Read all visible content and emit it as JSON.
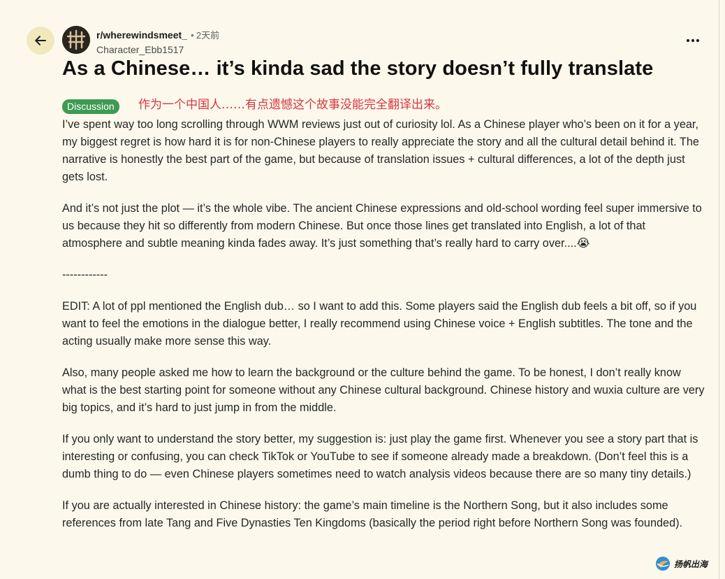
{
  "header": {
    "subreddit": "r/wherewindsmeet_",
    "separator": "•",
    "time": "2天前",
    "author": "Character_Ebb1517",
    "back_icon": "arrow-left-icon",
    "more_icon": "more-horizontal-icon"
  },
  "post": {
    "title": "As a Chinese… it’s kinda sad the story doesn’t fully translate",
    "flair": "Discussion",
    "title_translation": "作为一个中国人……有点遗憾这个故事没能完全翻译出来。",
    "paragraphs": [
      "I’ve spent way too long scrolling through WWM reviews just out of curiosity lol. As a Chinese player who’s been on it for a year, my biggest regret is how hard it is for non-Chinese players to really appreciate the story and all the cultural detail behind it. The narrative is honestly the best part of the game, but because of translation issues + cultural differences, a lot of the depth just gets lost.",
      "And it’s not just the plot — it’s the whole vibe. The ancient Chinese expressions and old-school wording feel super immersive to us because they hit so differently from modern Chinese. But once those lines get translated into English, a lot of that atmosphere and subtle meaning kinda fades away. It’s just something that’s really hard to carry over....😭",
      "------------",
      "EDIT: A lot of ppl mentioned the English dub… so I want to add this. Some players said the English dub feels a bit off, so if you want to feel the emotions in the dialogue better, I really recommend using Chinese voice + English subtitles. The tone and the acting usually make more sense this way.",
      "Also, many people asked me how to learn the background or the culture behind the game. To be honest, I don’t really know what is the best starting point for someone without any Chinese cultural background. Chinese history and wuxia culture are very big topics, and it’s hard to just jump in from the middle.",
      "If you only want to understand the story better, my suggestion is: just play the game first. Whenever you see a story part that is interesting or confusing, you can check TikTok or YouTube to see if someone already made a breakdown. (Don’t feel this is a dumb thing to do — even Chinese players sometimes need to watch analysis videos because there are so many tiny details.)",
      "If you are actually interested in Chinese history: the game’s main timeline is the Northern Song, but it also includes some references from late Tang and Five Dynasties Ten Kingdoms (basically the period right before Northern Song was founded)."
    ]
  },
  "watermark": {
    "text": "扬帆出海",
    "icon": "globe-logo-icon"
  },
  "colors": {
    "background": "#fcf9ec",
    "back_button_bg": "#f1e9bd",
    "flair_bg": "#3f9a53",
    "translation_text": "#d8363e"
  }
}
